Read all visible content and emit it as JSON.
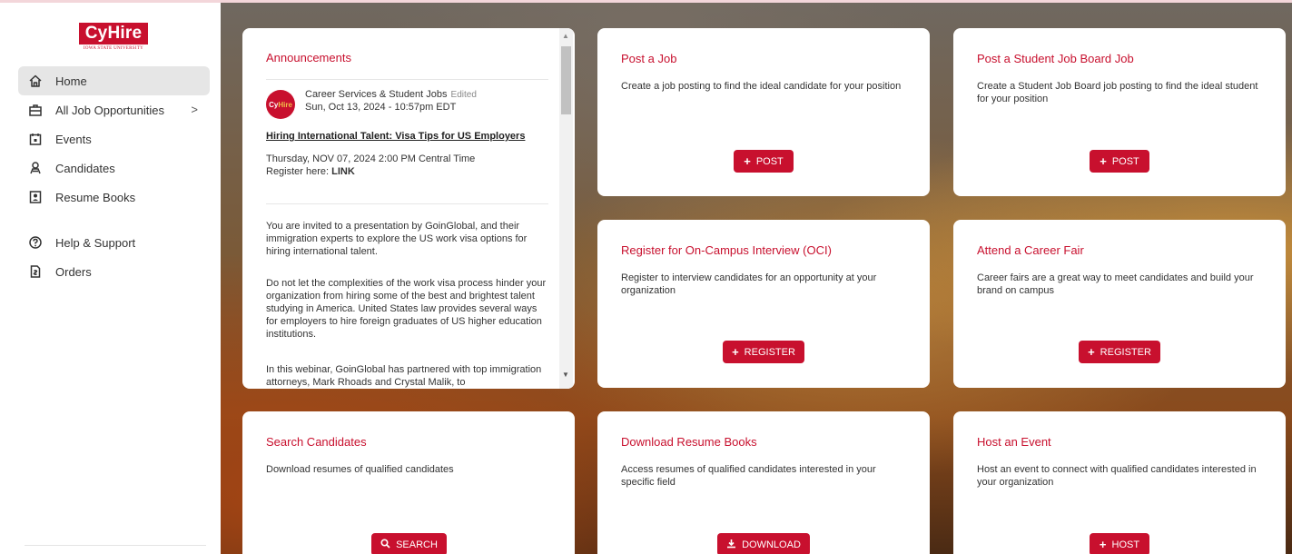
{
  "brand": {
    "name": "CyHire",
    "sub": "IOWA STATE UNIVERSITY",
    "color": "#c8102e"
  },
  "nav": {
    "items": [
      {
        "label": "Home",
        "icon": "home-icon"
      },
      {
        "label": "All Job Opportunities",
        "icon": "briefcase-icon",
        "chevron": ">"
      },
      {
        "label": "Events",
        "icon": "calendar-icon"
      },
      {
        "label": "Candidates",
        "icon": "candidates-icon"
      },
      {
        "label": "Resume Books",
        "icon": "resume-book-icon"
      },
      {
        "label": "Help & Support",
        "icon": "help-icon"
      },
      {
        "label": "Orders",
        "icon": "orders-icon"
      }
    ]
  },
  "announcements": {
    "heading": "Announcements",
    "avatar_text_a": "Cy",
    "avatar_text_b": "Hire",
    "author": "Career Services & Student Jobs",
    "edited": "Edited",
    "date": "Sun, Oct 13, 2024 - 10:57pm EDT",
    "title": "Hiring International Talent: Visa Tips for US Employers",
    "when": "Thursday, NOV 07, 2024 2:00 PM Central Time",
    "register_prefix": "Register here: ",
    "register_link": "LINK",
    "para1": "You are invited to a presentation by GoinGlobal, and their immigration experts to explore the US work visa options for hiring international talent.",
    "para2": "Do not let the complexities of the work visa process hinder your organization from hiring some of the best and brightest talent studying in America. United States law provides several ways for employers to hire foreign graduates of US higher education institutions.",
    "para3": "In this webinar, GoinGlobal has partnered with top immigration attorneys, Mark Rhoads and Crystal Malik, to"
  },
  "cards": {
    "post_job": {
      "title": "Post a Job",
      "desc": "Create a job posting to find the ideal candidate for your position",
      "button": "POST"
    },
    "post_student": {
      "title": "Post a Student Job Board Job",
      "desc": "Create a Student Job Board job posting to find the ideal student for your position",
      "button": "POST"
    },
    "oci": {
      "title": "Register for On-Campus Interview (OCI)",
      "desc": "Register to interview candidates for an opportunity at your organization",
      "button": "REGISTER"
    },
    "career_fair": {
      "title": "Attend a Career Fair",
      "desc": "Career fairs are a great way to meet candidates and build your brand on campus",
      "button": "REGISTER"
    },
    "search": {
      "title": "Search Candidates",
      "desc": "Download resumes of qualified candidates",
      "button": "SEARCH"
    },
    "resume_books": {
      "title": "Download Resume Books",
      "desc": "Access resumes of qualified candidates interested in your specific field",
      "button": "DOWNLOAD"
    },
    "host_event": {
      "title": "Host an Event",
      "desc": "Host an event to connect with qualified candidates interested in your organization",
      "button": "HOST"
    }
  }
}
